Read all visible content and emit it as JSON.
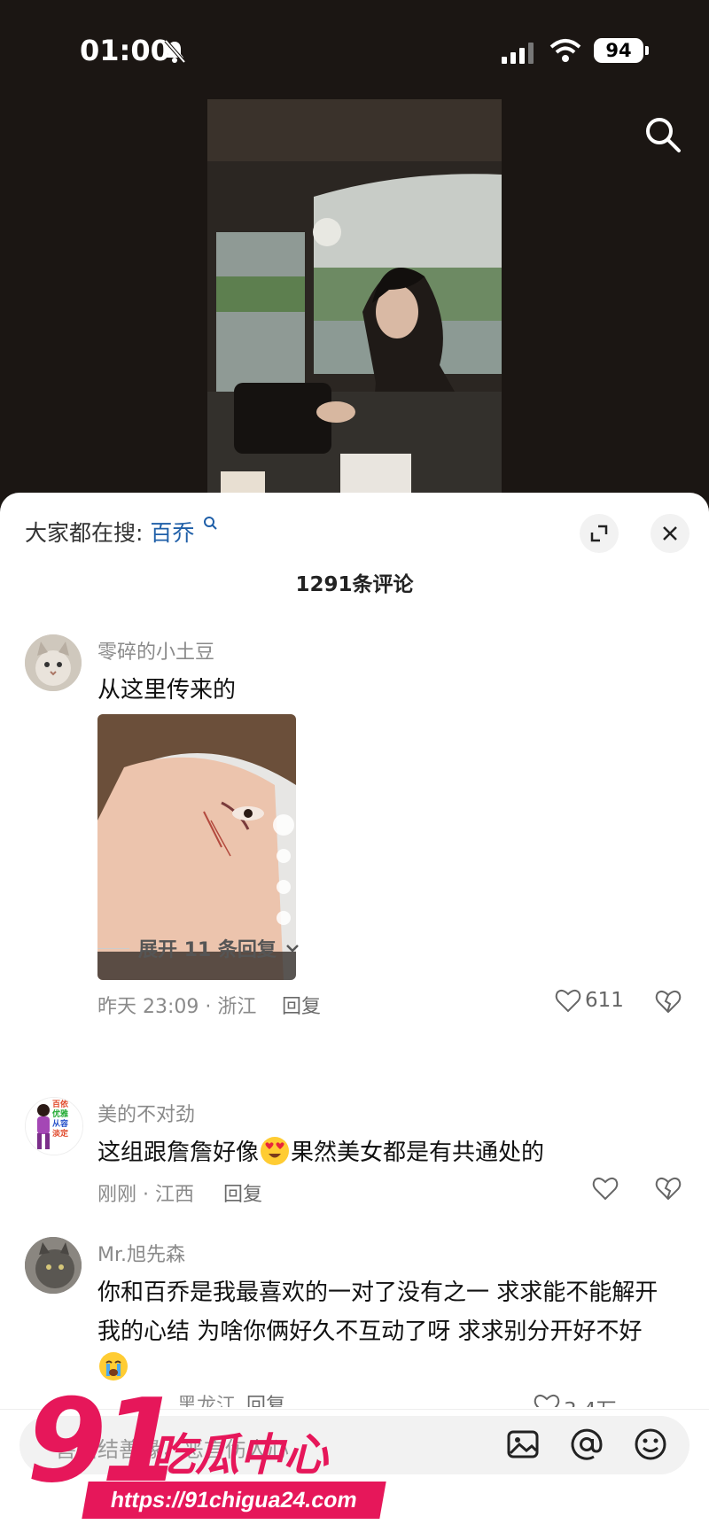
{
  "status_bar": {
    "time": "01:00",
    "battery": "94"
  },
  "comments_sheet": {
    "hot_search_label": "大家都在搜:",
    "hot_search_keyword": "百乔",
    "comment_count": "1291条评论",
    "comments": [
      {
        "username": "零碎的小土豆",
        "text": "从这里传来的",
        "time_location": "昨天 23:09 · 浙江",
        "reply_label": "回复",
        "likes": "611",
        "expand_replies": "展开 11 条回复"
      },
      {
        "username": "美的不对劲",
        "text_before_emoji": "这组跟詹詹好像",
        "text_after_emoji": "果然美女都是有共通处的",
        "time_location": "刚刚 · 江西",
        "reply_label": "回复"
      },
      {
        "username": "Mr.旭先森",
        "text_line1": "你和百乔是我最喜欢的一对了没有之一 求求能不能解开",
        "text_line2": "我的心结 为啥你俩好久不互动了呀 求求别分开好不好",
        "time_location": "黑龙江",
        "reply_label": "回复",
        "likes": "3.4万"
      }
    ]
  },
  "avatar_badge": {
    "line1": "百依",
    "line2": "优雅",
    "line3": "从容",
    "line4": "淡定"
  },
  "input_bar": {
    "placeholder": "善语结善缘，恶言伤人心"
  },
  "watermark": {
    "number": "91",
    "title": "吃瓜中心",
    "url": "https://91chigua24.com"
  },
  "colors": {
    "link_blue": "#1f5fa8",
    "watermark_pink": "#e6175a"
  }
}
